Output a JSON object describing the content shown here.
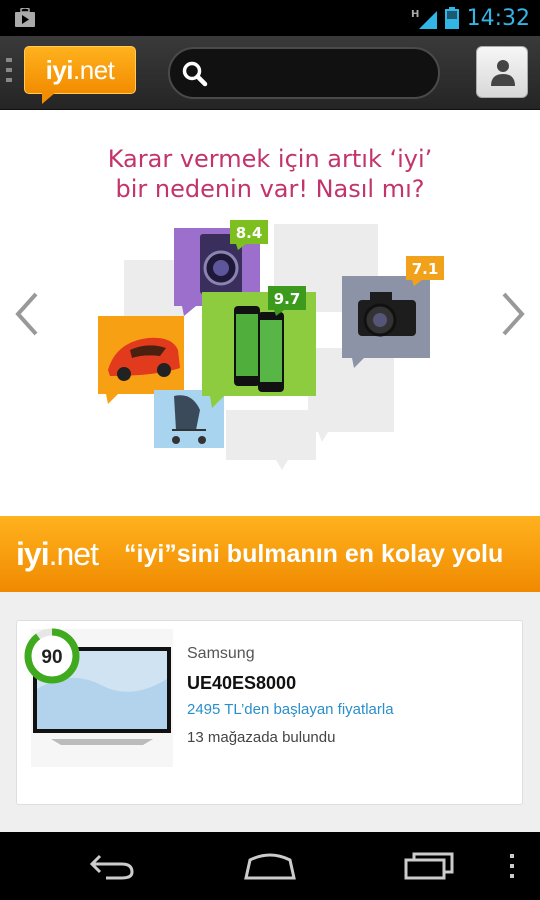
{
  "status_bar": {
    "time": "14:32",
    "network": "H",
    "icons": [
      "play-store-icon",
      "signal-icon",
      "battery-icon"
    ]
  },
  "app_bar": {
    "logo": {
      "main": "iyi",
      "suffix": ".net"
    },
    "search": {
      "value": "",
      "placeholder": ""
    },
    "icons": [
      "menu-icon",
      "search-icon",
      "user-icon"
    ]
  },
  "banner": {
    "headline_line1": "Karar vermek için artık ‘iyi’",
    "headline_line2": "bir nedenin var! Nasıl mı?",
    "scores": [
      "8.4",
      "9.7",
      "7.1"
    ],
    "icons": [
      "chevron-left-icon",
      "chevron-right-icon"
    ]
  },
  "slogan": {
    "logo_main": "iyi",
    "logo_suffix": ".net",
    "text": "“iyi”sini bulmanın en kolay yolu"
  },
  "product": {
    "score": "90",
    "score_fraction": 0.9,
    "brand": "Samsung",
    "model": "UE40ES8000",
    "price": "2495 TL’den başlayan fiyatlarla",
    "stores": "13 mağazada bulundu"
  },
  "nav_bar": {
    "icons": [
      "back-icon",
      "home-icon",
      "recent-apps-icon",
      "overflow-menu-icon"
    ]
  },
  "colors": {
    "accent_orange": "#f28c00",
    "headline_pink": "#c2346b",
    "link_blue": "#2a8fc9",
    "score_green": "#3faa1e",
    "status_blue": "#33b5e5"
  }
}
